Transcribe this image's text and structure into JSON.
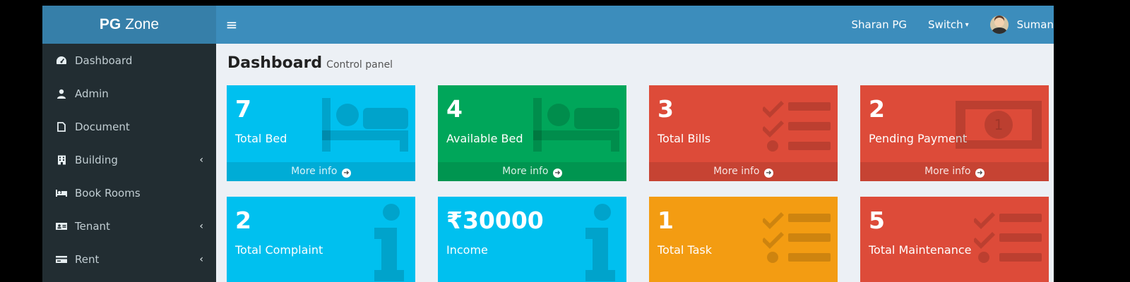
{
  "brand": {
    "bold": "PG",
    "light": "Zone"
  },
  "sidebar": {
    "items": [
      {
        "label": "Dashboard",
        "icon": "dashboard-icon"
      },
      {
        "label": "Admin",
        "icon": "user-icon"
      },
      {
        "label": "Document",
        "icon": "document-icon"
      },
      {
        "label": "Building",
        "icon": "building-icon",
        "chevron": "‹"
      },
      {
        "label": "Book Rooms",
        "icon": "bed-icon"
      },
      {
        "label": "Tenant",
        "icon": "id-card-icon",
        "chevron": "‹"
      },
      {
        "label": "Rent",
        "icon": "credit-card-icon",
        "chevron": "‹"
      }
    ]
  },
  "topbar": {
    "menu_icon": "≡",
    "pg_name": "Sharan PG",
    "switch_label": "Switch",
    "user_name": "Suman"
  },
  "page": {
    "title": "Dashboard",
    "subtitle": "Control panel"
  },
  "boxes": [
    {
      "value": "7",
      "label": "Total Bed",
      "more": "More info",
      "color": "#00c0ef",
      "icon": "bed-icon"
    },
    {
      "value": "4",
      "label": "Available Bed",
      "more": "More info",
      "color": "#00a65a",
      "icon": "bed-icon"
    },
    {
      "value": "3",
      "label": "Total Bills",
      "more": "More info",
      "color": "#dd4b39",
      "icon": "checklist-icon"
    },
    {
      "value": "2",
      "label": "Pending Payment",
      "more": "More info",
      "color": "#dd4b39",
      "icon": "money-icon"
    },
    {
      "value": "2",
      "label": "Total Complaint",
      "color": "#00c0ef",
      "icon": "info-icon"
    },
    {
      "value": "₹30000",
      "label": "Income",
      "color": "#00c0ef",
      "icon": "info-icon"
    },
    {
      "value": "1",
      "label": "Total Task",
      "color": "#f39c12",
      "icon": "checklist-icon"
    },
    {
      "value": "5",
      "label": "Total Maintenance",
      "color": "#dd4b39",
      "icon": "checklist-icon"
    }
  ]
}
